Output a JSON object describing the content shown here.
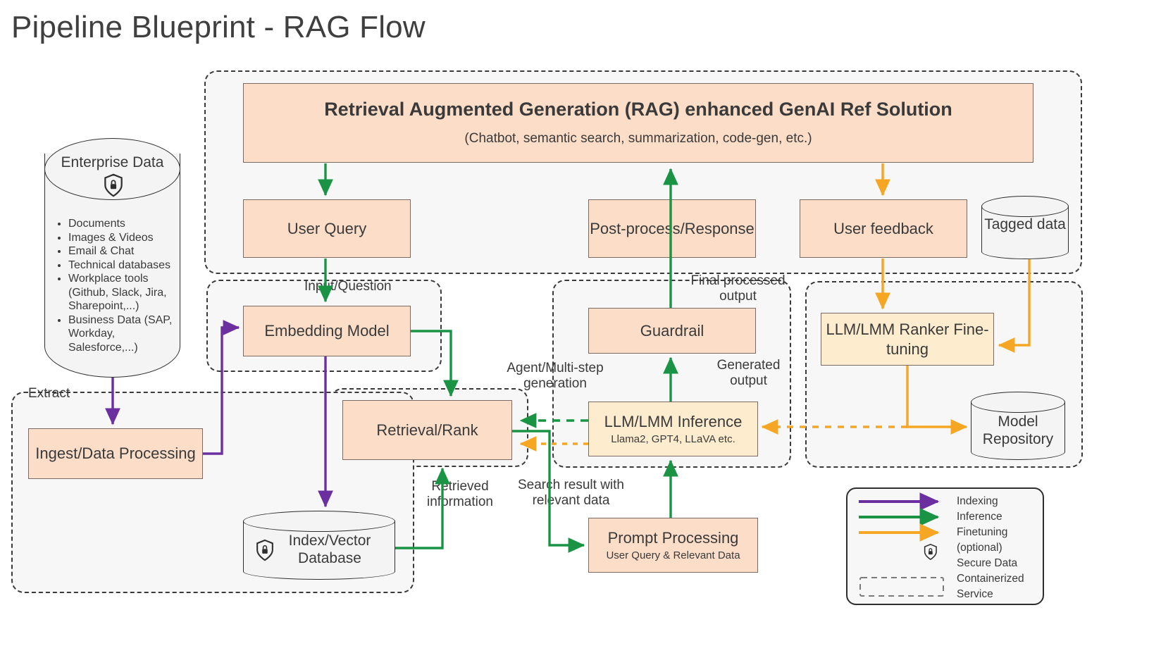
{
  "title": "Pipeline Blueprint - RAG Flow",
  "colors": {
    "indexing": "#6b2fa0",
    "inference": "#1a9444",
    "finetuning": "#f5a623",
    "box_fill": "#fbddc8",
    "box_yellow": "#fdeccd",
    "box_stroke": "#7a6a63",
    "container_stroke": "#3a3a3a"
  },
  "enterprise": {
    "label": "Enterprise Data",
    "icon": "shield-lock-icon",
    "items": [
      "Documents",
      "Images & Videos",
      "Email & Chat",
      "Technical databases",
      "Workplace tools (Github, Slack, Jira, Sharepoint,...)",
      "Business Data (SAP, Workday, Salesforce,...)"
    ]
  },
  "boxes": {
    "hero_title": "Retrieval Augmented Generation (RAG) enhanced GenAI Ref Solution",
    "hero_sub": "(Chatbot, semantic search, summarization, code-gen, etc.)",
    "user_query": "User Query",
    "post_process": "Post-process/Response",
    "user_feedback": "User feedback",
    "embedding_model": "Embedding Model",
    "guardrail": "Guardrail",
    "ranker_finetune": "LLM/LMM Ranker Fine-tuning",
    "ingest": "Ingest/Data Processing",
    "retrieval_rank": "Retrieval/Rank",
    "llm_inference": "LLM/LMM Inference",
    "llm_inference_sub": "Llama2, GPT4, LLaVA etc.",
    "prompt_processing": "Prompt Processing",
    "prompt_processing_sub": "User Query & Relevant Data"
  },
  "cylinders": {
    "tagged_data": "Tagged data",
    "model_repository": "Model Repository",
    "index_vector_db": "Index/Vector Database"
  },
  "edge_labels": {
    "extract": "Extract",
    "input_question": "Input/Question",
    "final_processed_output": "Final processed output",
    "generated_output": "Generated output",
    "agent_multistep": "Agent/Multi-step generation",
    "retrieved_information": "Retrieved information",
    "search_result": "Search result with relevant data"
  },
  "legend": {
    "items": [
      {
        "kind": "arrow",
        "color": "#6b2fa0",
        "label": "Indexing"
      },
      {
        "kind": "arrow",
        "color": "#1a9444",
        "label": "Inference"
      },
      {
        "kind": "arrow",
        "color": "#f5a623",
        "label": "Finetuning (optional)"
      },
      {
        "kind": "shield",
        "label": "Secure Data"
      },
      {
        "kind": "dashed-box",
        "label": "Containerized Service"
      }
    ],
    "rows": [
      "Indexing",
      "Inference",
      "Finetuning",
      "(optional)",
      "Secure Data",
      "Containerized",
      "Service"
    ]
  }
}
